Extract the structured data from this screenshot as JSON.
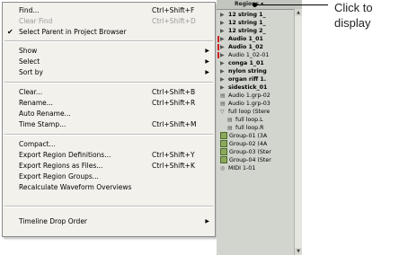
{
  "menu": {
    "items": [
      {
        "label": "Find...",
        "shortcut": "Ctrl+Shift+F",
        "disabled": false
      },
      {
        "label": "Clear Find",
        "shortcut": "Ctrl+Shift+D",
        "disabled": true
      },
      {
        "label": "Select Parent in Project Browser",
        "shortcut": "",
        "checked": true
      },
      {
        "label": "Show",
        "submenu": true
      },
      {
        "label": "Select",
        "submenu": true
      },
      {
        "label": "Sort by",
        "submenu": true
      },
      {
        "label": "Clear...",
        "shortcut": "Ctrl+Shift+B"
      },
      {
        "label": "Rename...",
        "shortcut": "Ctrl+Shift+R"
      },
      {
        "label": "Auto Rename..."
      },
      {
        "label": "Time Stamp...",
        "shortcut": "Ctrl+Shift+M"
      },
      {
        "label": "Compact..."
      },
      {
        "label": "Export Region Definitions...",
        "shortcut": "Ctrl+Shift+Y"
      },
      {
        "label": "Export Regions as Files...",
        "shortcut": "Ctrl+Shift+K"
      },
      {
        "label": "Export Region Groups..."
      },
      {
        "label": "Recalculate Waveform Overviews"
      },
      {
        "label": "Timeline Drop Order",
        "submenu": true
      }
    ],
    "check_glyph": "✔",
    "submenu_glyph": "▶"
  },
  "regions": {
    "header": "Regions ▾",
    "items": [
      {
        "label": "12 string 1_",
        "bold": true
      },
      {
        "label": "12 string 1_",
        "bold": true
      },
      {
        "label": "12 string 2_",
        "bold": true
      },
      {
        "label": "Audio 1_01",
        "bold": true,
        "red": true
      },
      {
        "label": "Audio 1_02",
        "bold": true,
        "red": true
      },
      {
        "label": "Audio 1_02-01",
        "red": true
      },
      {
        "label": "conga 1_01",
        "bold": true
      },
      {
        "label": "nylon string",
        "bold": true
      },
      {
        "label": "organ riff 1.",
        "bold": true
      },
      {
        "label": "sidestick_01",
        "bold": true
      },
      {
        "label": "Audio 1.grp-02"
      },
      {
        "label": "Audio 1.grp-03"
      },
      {
        "label": "full loop (Stere"
      },
      {
        "label": "full loop.L"
      },
      {
        "label": "full loop.R"
      },
      {
        "label": "Group-01 (3A"
      },
      {
        "label": "Group-02 (4A"
      },
      {
        "label": "Group-03 (Ster"
      },
      {
        "label": "Group-04 (Ster"
      },
      {
        "label": "MIDI 1-01"
      }
    ],
    "scroll_up": "▲",
    "scroll_down": "▼"
  },
  "callout": {
    "line1": "Click to",
    "line2": "display"
  },
  "colors": {
    "menu_bg": "#f2f1ec",
    "bin_bg": "#d2d5ce",
    "disabled": "#9a9a9a",
    "red_mark": "#cc2222"
  }
}
